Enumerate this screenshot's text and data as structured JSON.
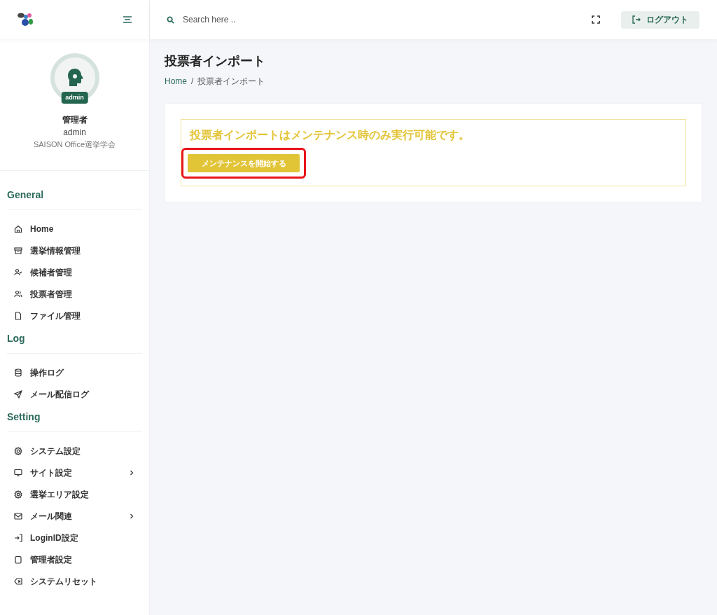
{
  "header": {
    "search": {
      "placeholder": "Search here .."
    },
    "logout_button": "ログアウト"
  },
  "profile": {
    "badge": "admin",
    "role": "管理者",
    "username": "admin",
    "organization": "SAISON Office選挙学会"
  },
  "sidebar": {
    "sections": [
      {
        "title": "General",
        "items": [
          {
            "label": "Home",
            "has_submenu": false
          },
          {
            "label": "選挙情報管理",
            "has_submenu": false
          },
          {
            "label": "候補者管理",
            "has_submenu": false
          },
          {
            "label": "投票者管理",
            "has_submenu": false
          },
          {
            "label": "ファイル管理",
            "has_submenu": false
          }
        ]
      },
      {
        "title": "Log",
        "items": [
          {
            "label": "操作ログ",
            "has_submenu": false
          },
          {
            "label": "メール配信ログ",
            "has_submenu": false
          }
        ]
      },
      {
        "title": "Setting",
        "items": [
          {
            "label": "システム設定",
            "has_submenu": false
          },
          {
            "label": "サイト設定",
            "has_submenu": true
          },
          {
            "label": "選挙エリア設定",
            "has_submenu": false
          },
          {
            "label": "メール関連",
            "has_submenu": true
          },
          {
            "label": "LoginID設定",
            "has_submenu": false
          },
          {
            "label": "管理者設定",
            "has_submenu": false
          },
          {
            "label": "システムリセット",
            "has_submenu": false
          }
        ]
      }
    ]
  },
  "page": {
    "title": "投票者インポート",
    "breadcrumb_separator": "/",
    "breadcrumb": [
      {
        "label": "Home",
        "link": true
      },
      {
        "label": "投票者インポート",
        "link": false
      }
    ],
    "alert": {
      "message": "投票者インポートはメンテナンス時のみ実行可能です。",
      "button": {
        "label": "メンテナンスを開始する",
        "highlighted": true
      }
    }
  }
}
